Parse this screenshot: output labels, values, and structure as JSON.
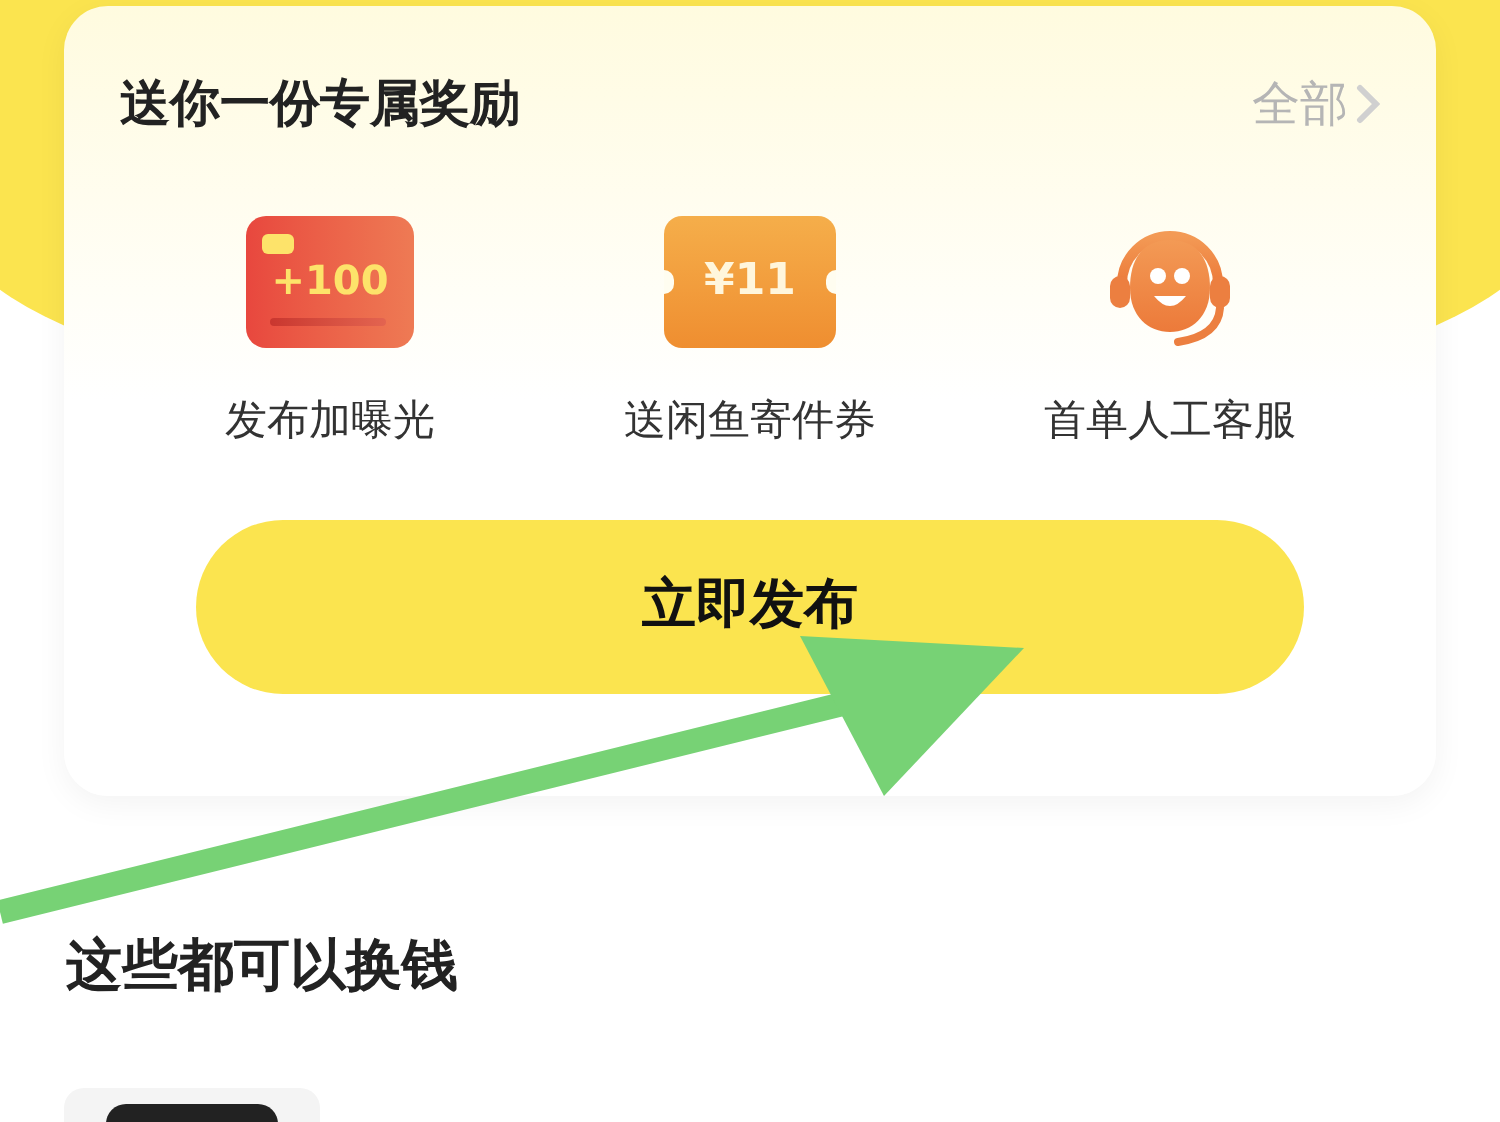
{
  "rewards_card": {
    "title": "送你一份专属奖励",
    "all_link": "全部",
    "rewards": [
      {
        "kind": "card",
        "badge": "+100",
        "label": "发布加曝光"
      },
      {
        "kind": "ticket",
        "badge": "¥11",
        "label": "送闲鱼寄件券"
      },
      {
        "kind": "service",
        "label": "首单人工客服"
      }
    ],
    "publish_button": "立即发布"
  },
  "section": {
    "title": "这些都可以换钱"
  }
}
